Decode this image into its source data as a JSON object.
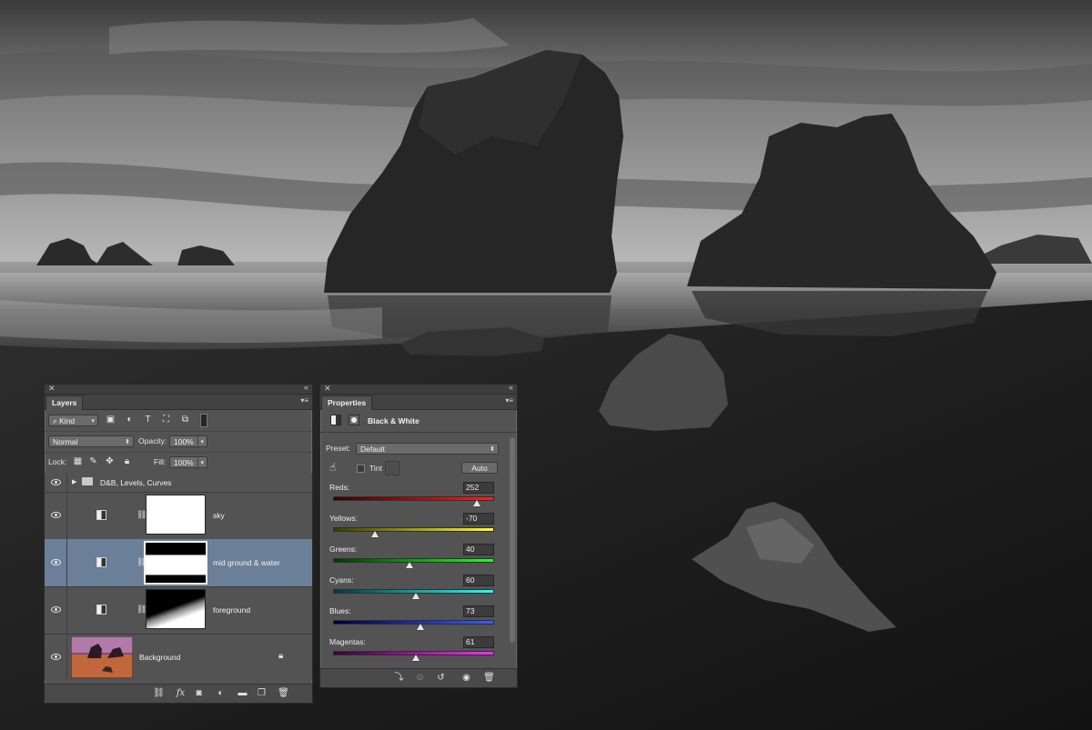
{
  "colors": {
    "panel_bg": "#535353",
    "selection": "#6b7f99"
  },
  "layers_panel": {
    "close_icon": "close-icon",
    "collapse_icon": "double-chevron-icon",
    "tab_label": "Layers",
    "filter": {
      "kind_label": "Kind"
    },
    "blend_mode": "Normal",
    "opacity_label": "Opacity:",
    "opacity_value": "100%",
    "lock_label": "Lock:",
    "fill_label": "Fill:",
    "fill_value": "100%",
    "layers": [
      {
        "name": "D&B, Levels, Curves",
        "type": "group",
        "visible": true
      },
      {
        "name": "sky",
        "type": "adjustment-mask",
        "visible": true
      },
      {
        "name": "mid ground & water",
        "type": "adjustment-mask",
        "visible": true,
        "selected": true
      },
      {
        "name": "foreground",
        "type": "adjustment-mask",
        "visible": true
      },
      {
        "name": "Background",
        "type": "image",
        "visible": true,
        "locked": true
      }
    ]
  },
  "properties_panel": {
    "tab_label": "Properties",
    "adjustment_title": "Black & White",
    "preset_label": "Preset:",
    "preset_value": "Default",
    "tint_label": "Tint",
    "tint_checked": false,
    "auto_label": "Auto",
    "sliders": [
      {
        "label": "Reds:",
        "value": "252",
        "min": -200,
        "max": 300,
        "gradient": [
          "#3a0000",
          "#ff1f1f"
        ]
      },
      {
        "label": "Yellows:",
        "value": "-70",
        "min": -200,
        "max": 300,
        "gradient": [
          "#3a3a00",
          "#ffff2a"
        ]
      },
      {
        "label": "Greens:",
        "value": "40",
        "min": -200,
        "max": 300,
        "gradient": [
          "#003a00",
          "#22ff22"
        ]
      },
      {
        "label": "Cyans:",
        "value": "60",
        "min": -200,
        "max": 300,
        "gradient": [
          "#003a3a",
          "#22ffff"
        ]
      },
      {
        "label": "Blues:",
        "value": "73",
        "min": -200,
        "max": 300,
        "gradient": [
          "#00003a",
          "#3b5bff"
        ]
      },
      {
        "label": "Magentas:",
        "value": "61",
        "min": -200,
        "max": 300,
        "gradient": [
          "#3a003a",
          "#ff2aff"
        ]
      }
    ]
  }
}
